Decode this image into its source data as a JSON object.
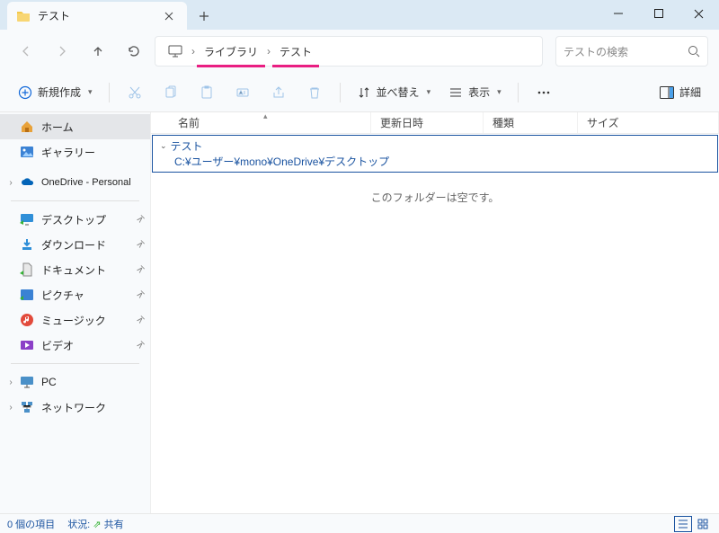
{
  "tab": {
    "title": "テスト"
  },
  "breadcrumb": {
    "root_glyph": "pc-icon",
    "items": [
      "ライブラリ",
      "テスト"
    ]
  },
  "search": {
    "placeholder": "テストの検索"
  },
  "toolbar": {
    "new_label": "新規作成",
    "sort_label": "並べ替え",
    "view_label": "表示",
    "details_label": "詳細"
  },
  "columns": {
    "name": "名前",
    "date": "更新日時",
    "type": "種類",
    "size": "サイズ"
  },
  "group": {
    "title": "テスト",
    "path": "C:¥ユーザー¥mono¥OneDrive¥デスクトップ"
  },
  "empty_message": "このフォルダーは空です。",
  "sidebar": {
    "home": "ホーム",
    "gallery": "ギャラリー",
    "onedrive": "OneDrive - Personal",
    "desktop": "デスクトップ",
    "downloads": "ダウンロード",
    "documents": "ドキュメント",
    "pictures": "ピクチャ",
    "music": "ミュージック",
    "videos": "ビデオ",
    "pc": "PC",
    "network": "ネットワーク"
  },
  "statusbar": {
    "count": "0 個の項目",
    "state_label": "状況:",
    "state_value": "共有"
  }
}
